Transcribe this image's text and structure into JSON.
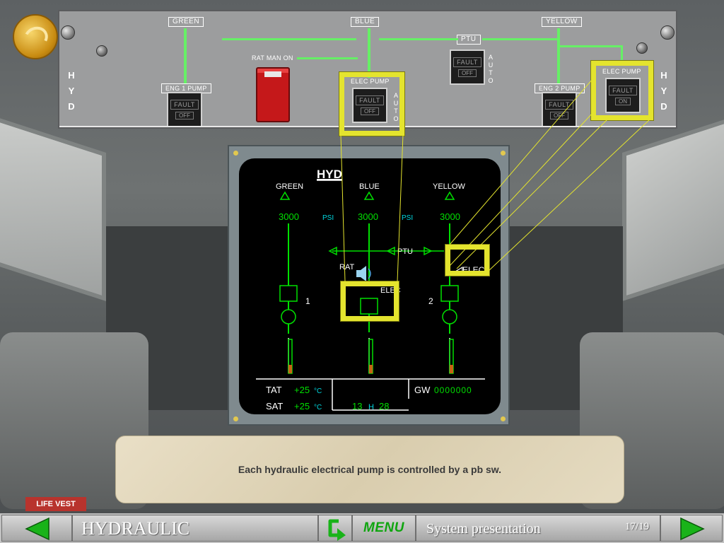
{
  "overhead": {
    "side_label": [
      "H",
      "Y",
      "D"
    ],
    "systems": {
      "green": "GREEN",
      "blue": "BLUE",
      "yellow": "YELLOW",
      "ptu": "PTU"
    },
    "eng1_pump": {
      "label": "ENG 1 PUMP",
      "fault": "FAULT",
      "state": "OFF"
    },
    "rat_man_on": "RAT MAN ON",
    "elec_pump_blue": {
      "label": "ELEC PUMP",
      "fault": "FAULT",
      "state": "OFF",
      "auto": [
        "A",
        "U",
        "T",
        "O"
      ]
    },
    "ptu_pb": {
      "fault": "FAULT",
      "state": "OFF",
      "auto": [
        "A",
        "U",
        "T",
        "O"
      ]
    },
    "eng2_pump": {
      "label": "ENG 2 PUMP",
      "fault": "FAULT",
      "state": "OFF"
    },
    "elec_pump_yellow": {
      "label": "ELEC PUMP",
      "fault": "FAULT",
      "state": "ON"
    }
  },
  "ecam": {
    "title": "HYD",
    "green": {
      "name": "GREEN",
      "pressure": "3000",
      "pump_num": "1"
    },
    "blue": {
      "name": "BLUE",
      "pressure": "3000"
    },
    "yellow": {
      "name": "YELLOW",
      "pressure": "3000",
      "pump_num": "2"
    },
    "psi": "PSI",
    "ptu": "PTU",
    "rat": "RAT",
    "elec_left": "ELEC",
    "elec_right": "ELEC",
    "tat_label": "TAT",
    "tat_value": "+25",
    "sat_label": "SAT",
    "sat_value": "+25",
    "temp_unit": "°C",
    "time_h": "13",
    "time_sep": "H",
    "time_m": "28",
    "gw_label": "GW",
    "gw_value": "0000000"
  },
  "info": {
    "text": "Each hydraulic electrical pump is controlled by a pb sw."
  },
  "nav": {
    "title": "HYDRAULIC",
    "menu": "MENU",
    "subtitle": "System presentation",
    "page": "17/19"
  },
  "colors": {
    "green_line": "#66f066",
    "highlight": "#e4e42e",
    "ecam_green": "#00e000",
    "ecam_cyan": "#00d8e0",
    "menu_green": "#0fa50f"
  }
}
